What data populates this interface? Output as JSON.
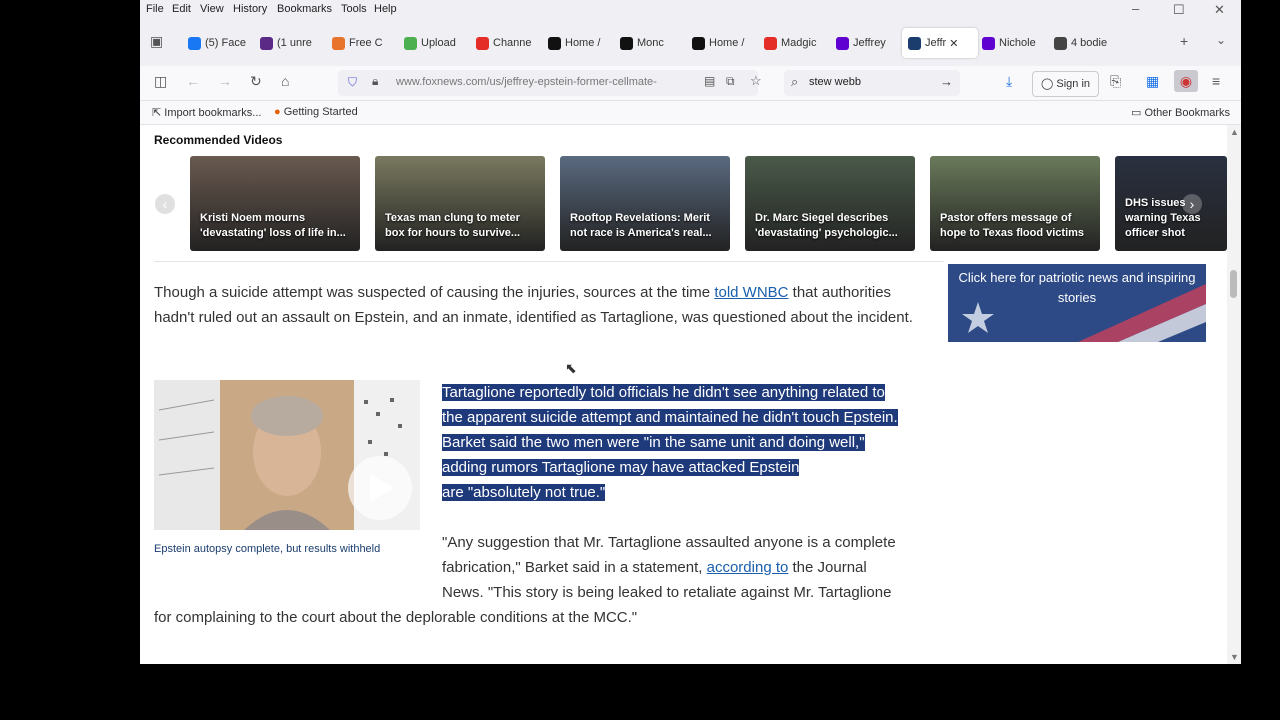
{
  "menu": [
    "File",
    "Edit",
    "View",
    "History",
    "Bookmarks",
    "Tools",
    "Help"
  ],
  "tabs": [
    {
      "label": "(5) Face",
      "icon": "facebook-icon",
      "color": "#1877f2"
    },
    {
      "label": "(1 unre",
      "icon": "mail-icon",
      "color": "#5b2a86"
    },
    {
      "label": "Free C",
      "icon": "chat-icon",
      "color": "#e8742c"
    },
    {
      "label": "Upload",
      "icon": "play-icon",
      "color": "#4caf50"
    },
    {
      "label": "Channe",
      "icon": "youtube-icon",
      "color": "#e52d27"
    },
    {
      "label": "Home /",
      "icon": "x-icon",
      "color": "#111111"
    },
    {
      "label": "Monc",
      "icon": "x-icon",
      "color": "#111111"
    },
    {
      "label": "Home /",
      "icon": "x-icon",
      "color": "#111111"
    },
    {
      "label": "Madgic",
      "icon": "youtube-icon",
      "color": "#e52d27"
    },
    {
      "label": "Jeffrey",
      "icon": "yahoo-icon",
      "color": "#5f01d1"
    },
    {
      "label": "Jeffr",
      "icon": "fox-icon",
      "color": "#1a3d6e",
      "active": true
    },
    {
      "label": "Nichole",
      "icon": "yahoo-icon",
      "color": "#5f01d1"
    },
    {
      "label": "4 bodie",
      "icon": "link-icon",
      "color": "#444444"
    }
  ],
  "nav": {
    "url": "www.foxnews.com/us/jeffrey-epstein-former-cellmate-",
    "search": "stew webb",
    "signin": "Sign in"
  },
  "bookmarks": {
    "import": "Import bookmarks...",
    "started": "Getting Started",
    "other": "Other Bookmarks"
  },
  "videos": {
    "title": "Recommended Videos",
    "items": [
      {
        "caption": "Kristi Noem mourns 'devastating' loss of life in...",
        "bg": "#6a5a50"
      },
      {
        "caption": "Texas man clung to meter box for hours to survive...",
        "bg": "#7a7a60"
      },
      {
        "caption": "Rooftop Revelations: Merit not race is America's real...",
        "bg": "#5a6a80"
      },
      {
        "caption": "Dr. Marc Siegel describes 'devastating' psychologic...",
        "bg": "#4a5a4a"
      },
      {
        "caption": "Pastor offers message of hope to Texas flood victims",
        "bg": "#6a7a5a"
      },
      {
        "caption": "DHS issues warning Texas officer shot",
        "bg": "#2a3040"
      }
    ]
  },
  "article": {
    "p1_a": "Though a suicide attempt was suspected of causing the injuries, sources at the time ",
    "p1_link": "told WNBC",
    "p1_b": " that authorities hadn't ruled out an assault on Epstein, and an inmate, identified as Tartaglione, was questioned about the incident.",
    "hl1": "Tartaglione reportedly told officials he didn't see anything related to",
    "hl2": "the apparent suicide attempt and maintained he didn't touch Epstein.",
    "hl3": "Barket said the two men were \"in the same unit and doing well,\"",
    "hl4": "adding rumors Tartaglione may have attacked Epstein",
    "hl5": "are \"absolutely not true.\"",
    "q_l1": "\"Any suggestion that Mr. Tartaglione assaulted anyone is a complete",
    "q_l2a": "fabrication,\" Barket said in a statement, ",
    "q_link": "according to",
    "q_l2b": " the Journal",
    "q_l3": "News. \"This story is being leaked to retaliate against Mr. Tartaglione",
    "q_l4": "for complaining to the court about the deplorable conditions at the MCC.\"",
    "thumb_caption": "Epstein autopsy complete, but results withheld"
  },
  "ad": {
    "text": "Click here for patriotic news and inspiring stories"
  }
}
